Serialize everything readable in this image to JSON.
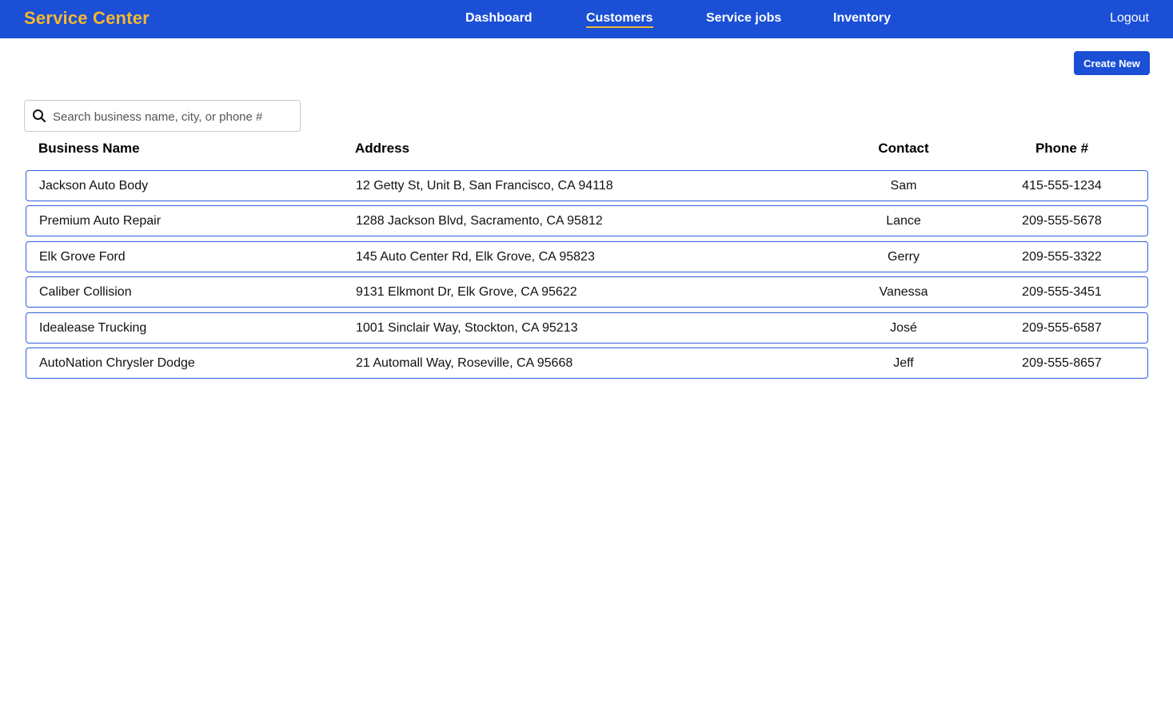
{
  "app": {
    "brand": "Service Center"
  },
  "nav": {
    "items": [
      {
        "label": "Dashboard"
      },
      {
        "label": "Customers"
      },
      {
        "label": "Service jobs"
      },
      {
        "label": "Inventory"
      }
    ],
    "active": "Customers",
    "logout_label": "Logout"
  },
  "toolbar": {
    "create_label": "Create New"
  },
  "search": {
    "placeholder": "Search business name, city, or phone #",
    "value": "",
    "icon": "search-icon"
  },
  "table": {
    "headers": {
      "name": "Business Name",
      "address": "Address",
      "contact": "Contact",
      "phone": "Phone #"
    },
    "rows": [
      {
        "name": "Jackson Auto Body",
        "address": "12 Getty St, Unit B, San Francisco, CA 94118",
        "contact": "Sam",
        "phone": "415-555-1234"
      },
      {
        "name": "Premium Auto Repair",
        "address": "1288 Jackson Blvd, Sacramento, CA 95812",
        "contact": "Lance",
        "phone": "209-555-5678"
      },
      {
        "name": "Elk Grove Ford",
        "address": "145 Auto Center Rd, Elk Grove, CA 95823",
        "contact": "Gerry",
        "phone": "209-555-3322"
      },
      {
        "name": "Caliber Collision",
        "address": "9131 Elkmont Dr, Elk Grove, CA 95622",
        "contact": "Vanessa",
        "phone": "209-555-3451"
      },
      {
        "name": "Idealease Trucking",
        "address": "1001 Sinclair Way, Stockton, CA 95213",
        "contact": "José",
        "phone": "209-555-6587"
      },
      {
        "name": "AutoNation Chrysler Dodge",
        "address": "21 Automall Way, Roseville, CA 95668",
        "contact": "Jeff",
        "phone": "209-555-8657"
      }
    ]
  },
  "colors": {
    "nav_bg": "#1a4fd6",
    "brand": "#f5b731",
    "row_border": "#2f5fd8"
  }
}
